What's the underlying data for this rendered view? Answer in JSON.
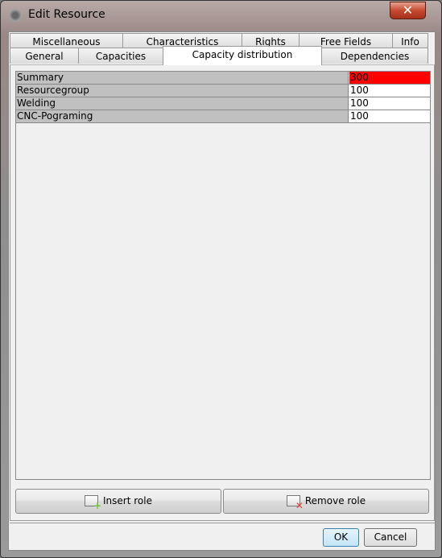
{
  "window": {
    "title": "Edit Resource",
    "close_icon": "close-icon"
  },
  "tabs_row1": [
    {
      "label": "Miscellaneous"
    },
    {
      "label": "Characteristics"
    },
    {
      "label": "Rights"
    },
    {
      "label": "Free Fields"
    },
    {
      "label": "Info"
    }
  ],
  "tabs_row2": [
    {
      "label": "General"
    },
    {
      "label": "Capacities"
    },
    {
      "label": "Capacity distribution",
      "selected": true
    },
    {
      "label": "Dependencies"
    }
  ],
  "table": {
    "rows": [
      {
        "label": "Summary",
        "value": "300",
        "highlight": "#ff0000"
      },
      {
        "label": "Resourcegroup",
        "value": "100"
      },
      {
        "label": "Welding",
        "value": "100"
      },
      {
        "label": "CNC-Pograming",
        "value": "100"
      }
    ]
  },
  "actions": {
    "insert_label": "Insert role",
    "remove_label": "Remove role"
  },
  "dialog": {
    "ok_label": "OK",
    "cancel_label": "Cancel"
  }
}
